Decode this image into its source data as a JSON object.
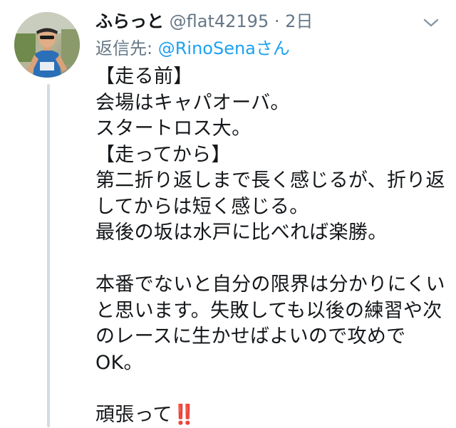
{
  "tweet": {
    "display_name": "ふらっと",
    "handle": "@flat42195",
    "separator": "·",
    "time": "2日",
    "reply_prefix": "返信先:",
    "reply_mention": "@RinoSena",
    "reply_suffix": "さん",
    "lines": [
      "【走る前】",
      "会場はキャパオーバ。",
      "スタートロス大。",
      "【走ってから】",
      "第二折り返しまで長く感じるが、折り返",
      "してからは短く感じる。",
      "最後の坂は水戸に比べれば楽勝。",
      "",
      "本番でないと自分の限界は分かりにくい",
      "と思います。失敗しても以後の練習や次",
      "のレースに生かせばよいので攻めで",
      "OK。",
      "",
      "頑張って"
    ],
    "closing_emoji": "‼️"
  },
  "colors": {
    "text": "#14171a",
    "secondary": "#657786",
    "link": "#1da1f2",
    "thread_line": "#d3dbe2",
    "emoji": "#d3213a"
  },
  "icons": {
    "avatar": "runner-photo-avatar",
    "menu": "chevron-down-icon"
  }
}
